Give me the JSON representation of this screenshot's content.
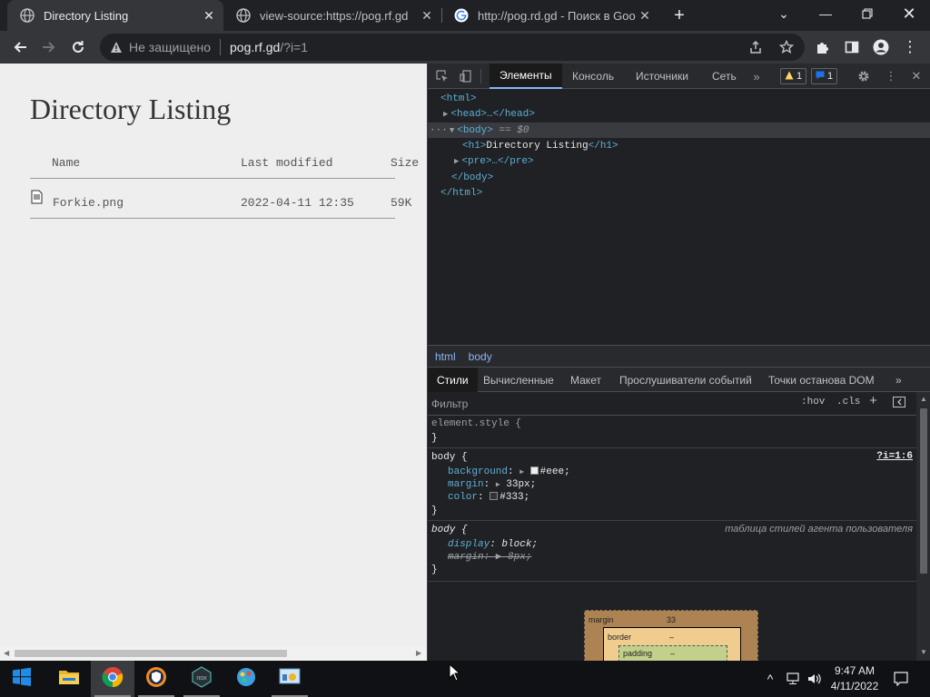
{
  "browser": {
    "tabs": [
      {
        "title": "Directory Listing",
        "icon": "globe-icon",
        "active": true
      },
      {
        "title": "view-source:https://pog.rf.gd",
        "icon": "globe-icon",
        "active": false
      },
      {
        "title": "http://pog.rd.gd - Поиск в Google",
        "icon": "google-icon",
        "active": false
      }
    ],
    "omnibox": {
      "security_label": "Не защищено",
      "host": "pog.rf.gd",
      "path": "/?i=1"
    }
  },
  "page": {
    "title": "Directory Listing",
    "columns": [
      "Name",
      "Last modified",
      "Size"
    ],
    "files": [
      {
        "name": "Forkie.png",
        "modified": "2022-04-11 12:35",
        "size": "59K",
        "icon": "file-icon"
      }
    ]
  },
  "devtools": {
    "tabs": [
      "Элементы",
      "Консоль",
      "Источники",
      "Сеть"
    ],
    "warnings_count": "1",
    "messages_count": "1",
    "dom": {
      "html_open": "<html>",
      "head": "<head>…</head>",
      "body_open": "<body>",
      "body_suffix": " == $0",
      "h1_open": "<h1>",
      "h1_text": "Directory Listing",
      "h1_close": "</h1>",
      "pre": "<pre>…</pre>",
      "body_close": "</body>",
      "html_close": "</html>",
      "ellipsis": "···"
    },
    "breadcrumbs": [
      "html",
      "body"
    ],
    "style_tabs": [
      "Стили",
      "Вычисленные",
      "Макет",
      "Прослушиватели событий",
      "Точки останова DOM"
    ],
    "filter_placeholder": "Фильтр",
    "hov_label": ":hov",
    "cls_label": ".cls",
    "rules": {
      "element_style": "element.style {",
      "close_brace": "}",
      "body_selector": "body {",
      "body_source": "?i=1:6",
      "body_props": [
        {
          "name": "background",
          "value": "#eee",
          "swatch": "#eeeeee"
        },
        {
          "name": "margin",
          "value": "33px"
        },
        {
          "name": "color",
          "value": "#333",
          "swatch": "#333333"
        }
      ],
      "ua_selector": "body {",
      "ua_source": "таблица стилей агента пользователя",
      "ua_props": [
        {
          "name": "display",
          "value": "block"
        },
        {
          "name": "margin",
          "value": "8px"
        }
      ]
    },
    "box_model": {
      "margin_label": "margin",
      "margin_value": "33",
      "border_label": "border",
      "border_value": "–",
      "padding_label": "padding",
      "padding_value": "–"
    }
  },
  "taskbar": {
    "time": "9:47 AM",
    "date": "4/11/2022"
  }
}
